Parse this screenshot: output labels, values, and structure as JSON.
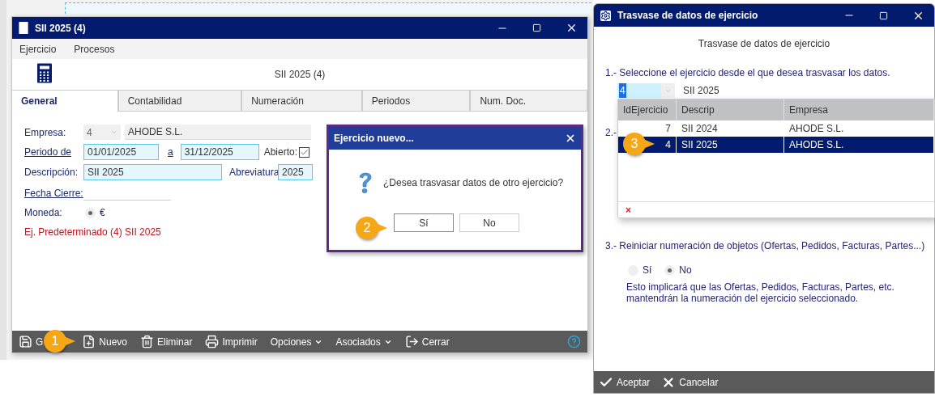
{
  "main_window": {
    "title": "SII 2025 (4)",
    "menu": [
      "Ejercicio",
      "Procesos"
    ],
    "header_title": "SII 2025 (4)",
    "tabs": [
      {
        "label": "General",
        "selected": true
      },
      {
        "label": "Contabilidad",
        "selected": false
      },
      {
        "label": "Numeración",
        "selected": false
      },
      {
        "label": "Periodos",
        "selected": false
      },
      {
        "label": "Num. Doc.",
        "selected": false
      }
    ],
    "form": {
      "empresa_label": "Empresa:",
      "empresa_code": "4",
      "empresa_name": "AHODE S.L.",
      "periodo_label": "Periodo de",
      "periodo_from": "01/01/2025",
      "periodo_a": "a",
      "periodo_to": "31/12/2025",
      "abierto_label": "Abierto:",
      "abierto_checked": true,
      "descripcion_label": "Descripción:",
      "descripcion": "SII 2025",
      "abreviatura_label": "Abreviatura",
      "abreviatura": "2025",
      "fecha_cierre_label": "Fecha Cierre:",
      "moneda_label": "Moneda:",
      "moneda": "€",
      "moneda_selected": true,
      "default_note": "Ej. Predeterminado (4) SII 2025"
    },
    "toolbar": [
      {
        "kind": "save",
        "label": "G"
      },
      {
        "kind": "new",
        "label": "Nuevo"
      },
      {
        "kind": "delete",
        "label": "Eliminar"
      },
      {
        "kind": "print",
        "label": "Imprimir"
      },
      {
        "kind": "dropdown",
        "label": "Opciones"
      },
      {
        "kind": "dropdown",
        "label": "Asociados"
      },
      {
        "kind": "close",
        "label": "Cerrar"
      }
    ]
  },
  "dialog": {
    "title": "Ejercicio nuevo...",
    "message": "¿Desea trasvasar datos de otro ejercicio?",
    "buttons": [
      {
        "label": "Sí",
        "focused": true
      },
      {
        "label": "No",
        "focused": false
      }
    ]
  },
  "transfer_window": {
    "title": "Trasvase de datos de ejercicio",
    "heading": "Trasvase de datos de ejercicio",
    "step1": "1.- Seleccione el ejercicio desde el que desea trasvasar los datos.",
    "combo_value": "4",
    "combo_description": "SII 2025",
    "step2": "2.-",
    "step3": "3.- Reiniciar numeración de objetos (Ofertas, Pedidos, Facturas, Partes...)",
    "radios": [
      {
        "label": "Sí",
        "selected": false
      },
      {
        "label": "No",
        "selected": true
      }
    ],
    "note": "Esto implicará que las Ofertas, Pedidos, Facturas, Partes, etc. mantendrán la numeración del ejercicio seleccionado.",
    "footer": [
      {
        "kind": "accept",
        "label": "Aceptar"
      },
      {
        "kind": "cancel",
        "label": "Cancelar"
      }
    ]
  },
  "dropdown_grid": {
    "columns": [
      "IdEjercicio",
      "Descrip",
      "Empresa"
    ],
    "rows": [
      {
        "cells": [
          "7",
          "SII 2024",
          "AHODE S.L."
        ],
        "selected": false
      },
      {
        "cells": [
          "4",
          "SII 2025",
          "AHODE S.L."
        ],
        "selected": true
      }
    ],
    "clear": "×"
  },
  "callouts": [
    {
      "number": "1"
    },
    {
      "number": "2"
    },
    {
      "number": "3"
    }
  ]
}
